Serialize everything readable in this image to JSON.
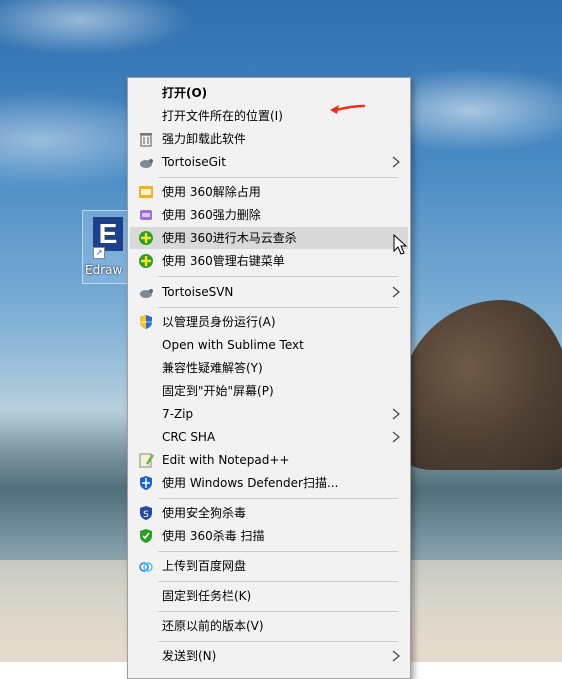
{
  "desktop": {
    "icon_label": "Edraw"
  },
  "context_menu": {
    "items": [
      {
        "label": "打开(O)",
        "icon": "",
        "submenu": false
      },
      {
        "label": "打开文件所在的位置(I)",
        "icon": "",
        "submenu": false
      },
      {
        "label": "强力卸载此软件",
        "icon": "trash-icon",
        "submenu": false
      },
      {
        "label": "TortoiseGit",
        "icon": "tortoisegit-icon",
        "submenu": true
      },
      {
        "label": "使用 360解除占用",
        "icon": "360-unlock-icon",
        "submenu": false
      },
      {
        "label": "使用 360强力删除",
        "icon": "360-shred-icon",
        "submenu": false
      },
      {
        "label": "使用 360进行木马云查杀",
        "icon": "360-scan-icon",
        "submenu": false
      },
      {
        "label": "使用 360管理右键菜单",
        "icon": "360-menu-manage-icon",
        "submenu": false
      },
      {
        "label": "TortoiseSVN",
        "icon": "tortoisesvn-icon",
        "submenu": true
      },
      {
        "label": "以管理员身份运行(A)",
        "icon": "uac-shield-icon",
        "submenu": false
      },
      {
        "label": "Open with Sublime Text",
        "icon": "",
        "submenu": false
      },
      {
        "label": "兼容性疑难解答(Y)",
        "icon": "",
        "submenu": false
      },
      {
        "label": "固定到\"开始\"屏幕(P)",
        "icon": "",
        "submenu": false
      },
      {
        "label": "7-Zip",
        "icon": "",
        "submenu": true
      },
      {
        "label": "CRC SHA",
        "icon": "",
        "submenu": true
      },
      {
        "label": "Edit with Notepad++",
        "icon": "notepadpp-icon",
        "submenu": false
      },
      {
        "label": "使用 Windows Defender扫描...",
        "icon": "defender-icon",
        "submenu": false
      },
      {
        "label": "使用安全狗杀毒",
        "icon": "safedog-icon",
        "submenu": false
      },
      {
        "label": "使用 360杀毒 扫描",
        "icon": "360-antivirus-icon",
        "submenu": false
      },
      {
        "label": "上传到百度网盘",
        "icon": "baidu-netdisk-icon",
        "submenu": false
      },
      {
        "label": "固定到任务栏(K)",
        "icon": "",
        "submenu": false
      },
      {
        "label": "还原以前的版本(V)",
        "icon": "",
        "submenu": false
      },
      {
        "label": "发送到(N)",
        "icon": "",
        "submenu": true
      }
    ]
  },
  "colors": {
    "highlight": "#ee3fac",
    "arrow": "#e8321c",
    "hover": "#d9d9d9"
  }
}
